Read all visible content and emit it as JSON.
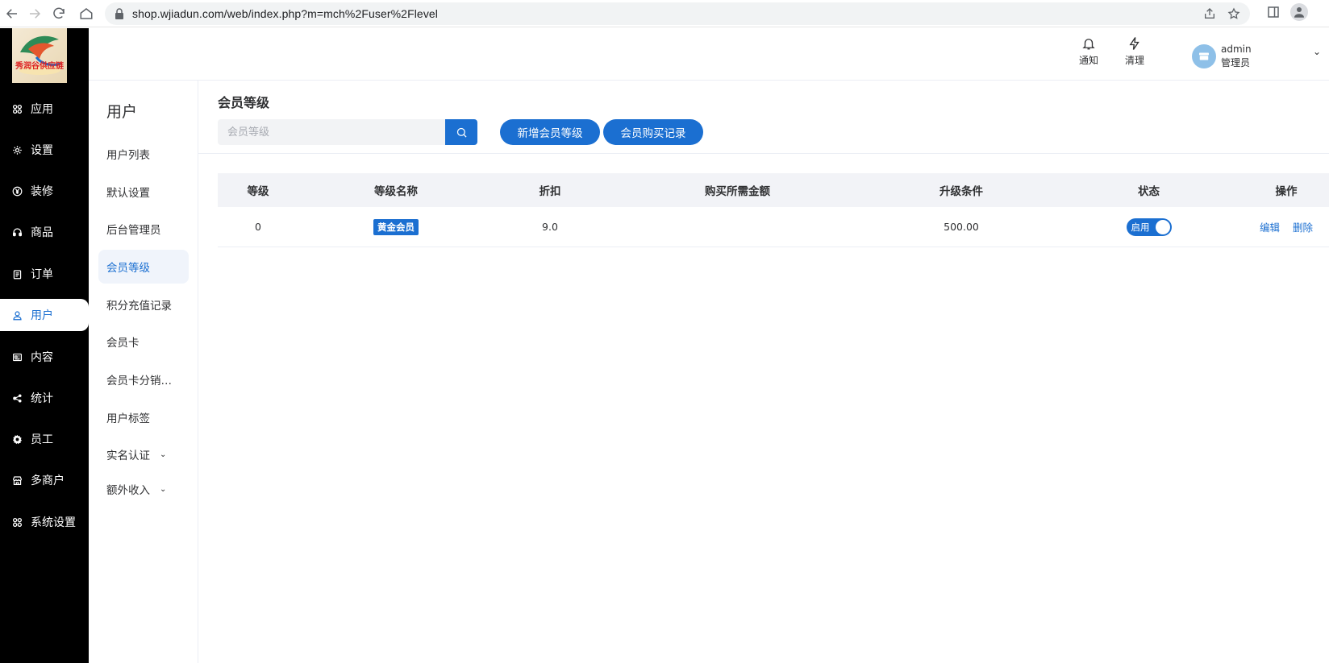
{
  "browser": {
    "url": "shop.wjiadun.com/web/index.php?m=mch%2Fuser%2Flevel"
  },
  "logo": {
    "text": "秀润谷供应链"
  },
  "sidebar": {
    "items": [
      {
        "label": "应用",
        "icon": "apps-icon"
      },
      {
        "label": "设置",
        "icon": "gear-icon"
      },
      {
        "label": "装修",
        "icon": "yen-icon"
      },
      {
        "label": "商品",
        "icon": "headset-icon"
      },
      {
        "label": "订单",
        "icon": "clipboard-icon"
      },
      {
        "label": "用户",
        "icon": "user-icon",
        "active": true
      },
      {
        "label": "内容",
        "icon": "news-icon"
      },
      {
        "label": "统计",
        "icon": "share-icon"
      },
      {
        "label": "员工",
        "icon": "cog-icon"
      },
      {
        "label": "多商户",
        "icon": "store-icon"
      },
      {
        "label": "系统设置",
        "icon": "apps-icon"
      }
    ]
  },
  "submenu": {
    "title": "用户",
    "items": [
      {
        "label": "用户列表"
      },
      {
        "label": "默认设置"
      },
      {
        "label": "后台管理员"
      },
      {
        "label": "会员等级",
        "active": true
      },
      {
        "label": "积分充值记录"
      },
      {
        "label": "会员卡"
      },
      {
        "label": "会员卡分销…"
      },
      {
        "label": "用户标签"
      },
      {
        "label": "实名认证",
        "expandable": true
      },
      {
        "label": "额外收入",
        "expandable": true
      }
    ]
  },
  "header": {
    "notify_label": "通知",
    "clear_label": "清理",
    "user_name": "admin",
    "user_role": "管理员"
  },
  "main": {
    "title": "会员等级",
    "search_placeholder": "会员等级",
    "add_button": "新增会员等级",
    "records_button": "会员购买记录",
    "table": {
      "headers": [
        "等级",
        "等级名称",
        "折扣",
        "购买所需金额",
        "升级条件",
        "状态",
        "操作"
      ],
      "rows": [
        {
          "level": "0",
          "name": "黄金会员",
          "discount": "9.0",
          "price": "",
          "upgrade": "500.00",
          "status": "启用",
          "status_on": true,
          "edit": "编辑",
          "delete": "删除"
        }
      ]
    }
  },
  "colors": {
    "accent": "#1b6fd1",
    "sidebar_bg": "#000000"
  }
}
